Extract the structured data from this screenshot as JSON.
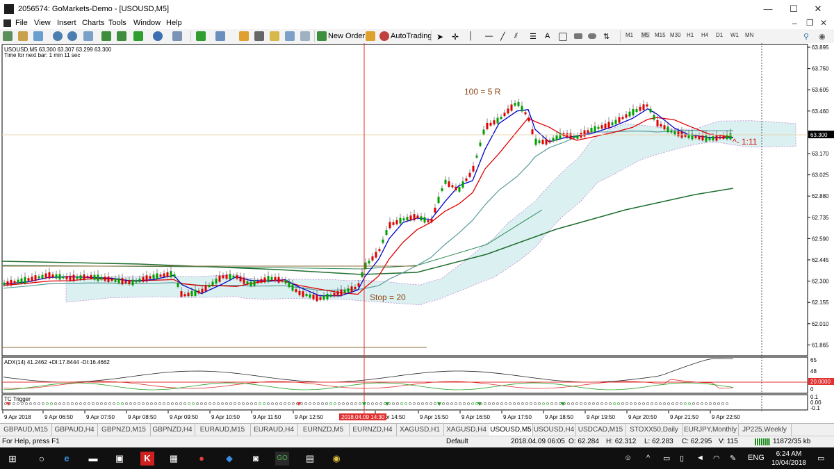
{
  "window": {
    "title": "2056574: GoMarkets-Demo - [USOUSD,M5]",
    "minimize": "—",
    "maximize": "☐",
    "close": "✕"
  },
  "menu": [
    "File",
    "View",
    "Insert",
    "Charts",
    "Tools",
    "Window",
    "Help"
  ],
  "toolbar": {
    "new_order": "New Order",
    "autotrading": "AutoTrading",
    "text_tool": "A",
    "timeframes": [
      "M1",
      "M5",
      "M15",
      "M30",
      "H1",
      "H4",
      "D1",
      "W1",
      "MN"
    ],
    "active_timeframe": "M5"
  },
  "chart": {
    "header": "USOUSD,M5  63.300 63.307 63.299 63.300",
    "next_bar": "Time for next bar: 1 min 11 sec",
    "price_labels": [
      "63.895",
      "63.750",
      "63.605",
      "63.460",
      "63.300",
      "63.170",
      "63.025",
      "62.880",
      "62.735",
      "62.590",
      "62.445",
      "62.300",
      "62.155",
      "62.010",
      "61.865"
    ],
    "current_price": "63.300",
    "annotation_r": "100 = 5 R",
    "annotation_stop": "Stop = 20",
    "annotation_ratio": "^- 1:11",
    "adx_label": "ADX(14) 41.2462 +DI:17.8444 -DI:16.4662",
    "adx_scale": [
      "65",
      "48",
      "20.0000",
      "0"
    ],
    "tc_label": "TC Trigger",
    "tc_scale": [
      "0.1",
      "0.00",
      "-0.1"
    ],
    "time_labels": [
      "9 Apr 2018",
      "9 Apr 06:50",
      "9 Apr 07:50",
      "9 Apr 08:50",
      "9 Apr 09:50",
      "9 Apr 10:50",
      "9 Apr 11:50",
      "9 Apr 12:50",
      "9 Apr 14:50",
      "9 Apr 15:50",
      "9 Apr 16:50",
      "9 Apr 17:50",
      "9 Apr 18:50",
      "9 Apr 19:50",
      "9 Apr 20:50",
      "9 Apr 21:50",
      "9 Apr 22:50"
    ],
    "crosshair_time": "2018.04.09 14:30",
    "colors": {
      "bull": "#00a000",
      "bear": "#e00000",
      "fast_ma": "#0000cc",
      "slow_ma": "#e00000",
      "ma_teal": "#5a9a9a",
      "ma_long": "#1e6e2e",
      "cloud": "#7ec8c8",
      "crosshair": "#e03030",
      "annotation": "#8b4513"
    }
  },
  "tabs": [
    "GBPAUD,M15",
    "GBPAUD,H4",
    "GBPNZD,M15",
    "GBPNZD,H4",
    "EURAUD,M15",
    "EURAUD,H4",
    "EURNZD,M5",
    "EURNZD,H4",
    "XAGUSD,H1",
    "XAGUSD,H4",
    "USOUSD,M5",
    "USOUSD,H4",
    "USDCAD,M15",
    "STOXX50,Daily",
    "EURJPY,Monthly",
    "JP225,Weekly"
  ],
  "active_tab": "USOUSD,M5",
  "status": {
    "help": "For Help, press F1",
    "profile": "Default",
    "time": "2018.04.09 06:05",
    "open": "O: 62.284",
    "high": "H: 62.312",
    "low": "L: 62.283",
    "close": "C: 62.295",
    "volume": "V: 115",
    "traffic": "11872/35 kb"
  },
  "taskbar": {
    "lang": "ENG",
    "time": "6:24 AM",
    "date": "10/04/2018"
  }
}
